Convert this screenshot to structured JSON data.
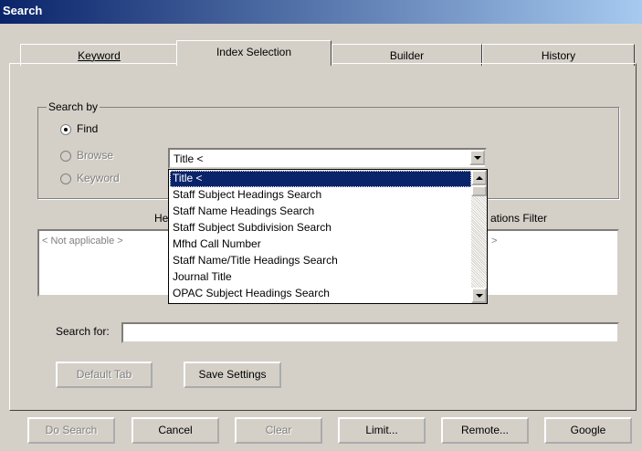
{
  "window": {
    "title": "Search"
  },
  "tabs": [
    {
      "label": "Keyword",
      "active": false
    },
    {
      "label": "Index Selection",
      "active": true
    },
    {
      "label": "Builder",
      "active": false
    },
    {
      "label": "History",
      "active": false
    }
  ],
  "search_by": {
    "legend": "Search by",
    "options": [
      {
        "label": "Find",
        "selected": true,
        "enabled": true
      },
      {
        "label": "Browse",
        "selected": false,
        "enabled": false
      },
      {
        "label": "Keyword",
        "selected": false,
        "enabled": false
      }
    ]
  },
  "index_combo": {
    "value": "Title <",
    "options": [
      "Title <",
      "Staff Subject Headings Search",
      "Staff Name Headings Search",
      "Staff Subject Subdivision Search",
      "Mfhd Call Number",
      "Staff Name/Title Headings Search",
      "Journal Title",
      "OPAC Subject Headings Search"
    ],
    "highlighted_index": 0
  },
  "left_list": {
    "header_partial": "He",
    "placeholder": "< Not applicable >"
  },
  "right_list": {
    "header_partial": "ations Filter",
    "placeholder_partial": ">"
  },
  "search_for": {
    "label": "Search for:",
    "value": ""
  },
  "buttons": {
    "default_tab": "Default Tab",
    "save_settings": "Save Settings",
    "do_search": "Do Search",
    "cancel": "Cancel",
    "clear": "Clear",
    "limit": "Limit...",
    "remote": "Remote...",
    "google": "Google"
  }
}
